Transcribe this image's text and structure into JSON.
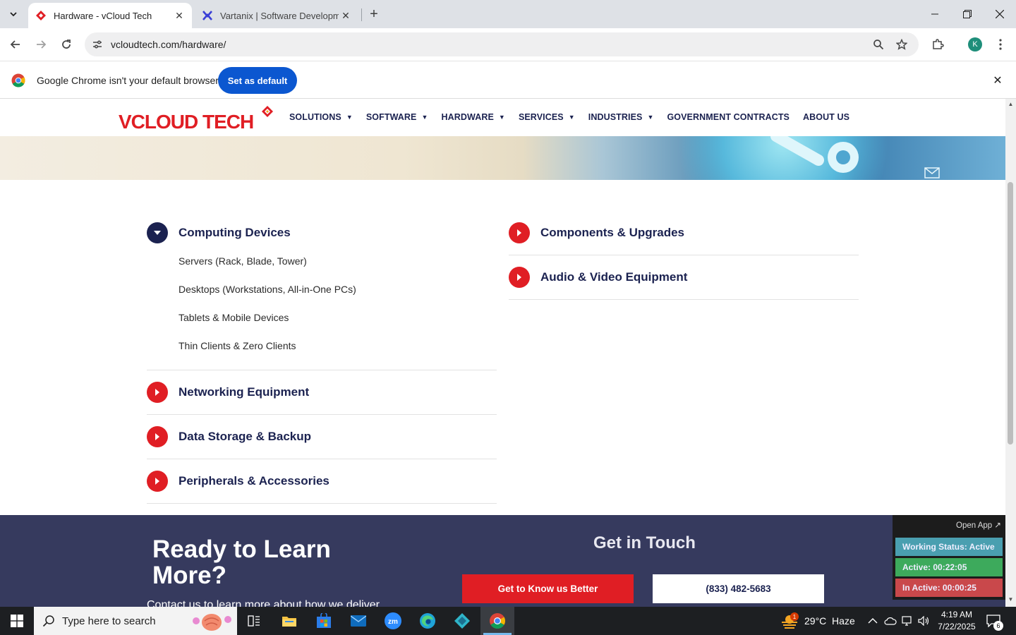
{
  "browser": {
    "tabs": [
      {
        "title": "Hardware - vCloud Tech",
        "active": true
      },
      {
        "title": "Vartanix | Software Development",
        "active": false
      }
    ],
    "url": "vcloudtech.com/hardware/",
    "avatar_letter": "K"
  },
  "infobar": {
    "message": "Google Chrome isn't your default browser",
    "button": "Set as default"
  },
  "site": {
    "logo_text": "VCLOUD TECH",
    "nav": [
      {
        "label": "SOLUTIONS",
        "has_dropdown": true
      },
      {
        "label": "SOFTWARE",
        "has_dropdown": true
      },
      {
        "label": "HARDWARE",
        "has_dropdown": true
      },
      {
        "label": "SERVICES",
        "has_dropdown": true
      },
      {
        "label": "INDUSTRIES",
        "has_dropdown": true
      },
      {
        "label": "GOVERNMENT CONTRACTS",
        "has_dropdown": false
      },
      {
        "label": "ABOUT US",
        "has_dropdown": false
      }
    ],
    "accordion_left": [
      {
        "title": "Computing Devices",
        "expanded": true,
        "items": [
          "Servers (Rack, Blade, Tower)",
          "Desktops (Workstations, All-in-One PCs)",
          "Tablets & Mobile Devices",
          "Thin Clients & Zero Clients"
        ]
      },
      {
        "title": "Networking Equipment",
        "expanded": false,
        "items": []
      },
      {
        "title": "Data Storage & Backup",
        "expanded": false,
        "items": []
      },
      {
        "title": "Peripherals & Accessories",
        "expanded": false,
        "items": []
      }
    ],
    "accordion_right": [
      {
        "title": "Components & Upgrades",
        "expanded": false
      },
      {
        "title": "Audio & Video Equipment",
        "expanded": false
      }
    ],
    "footer": {
      "heading_line1": "Ready to Learn",
      "heading_line2": "More?",
      "subtext": "Contact us to learn more about how we deliver",
      "get_in_touch": "Get in Touch",
      "cta_primary": "Get to Know us Better",
      "cta_phone": "(833) 482-5683"
    }
  },
  "widget": {
    "open_app": "Open App ↗",
    "working_status": "Working Status: Active",
    "active": "Active: 00:22:05",
    "inactive": "In Active: 00:00:25",
    "colors": {
      "working": "#4a9fb0",
      "active": "#3daa5c",
      "inactive": "#c9484b"
    }
  },
  "taskbar": {
    "search_placeholder": "Type here to search",
    "weather": "29°C  Haze",
    "weather_badge": "1",
    "time": "4:19 AM",
    "date": "7/22/2025",
    "notifications": "6"
  },
  "colors": {
    "brand_navy": "#1b2250",
    "brand_red": "#e01e24",
    "footer_bg": "#363a5e"
  }
}
